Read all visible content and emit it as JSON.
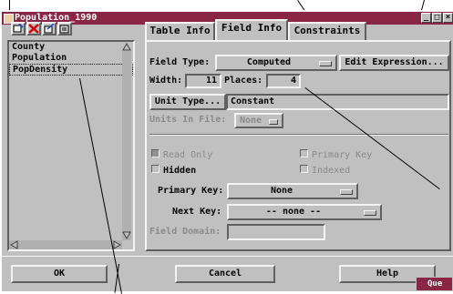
{
  "window": {
    "title": "Population_1990",
    "buttons": [
      "minimize-icon",
      "maximize-icon",
      "close-icon"
    ]
  },
  "toolbar": {
    "icons": [
      "add-field-icon",
      "delete-field-icon",
      "edit-icon",
      "import-icon"
    ]
  },
  "field_list": {
    "items": [
      "County",
      "Population",
      "PopDensity"
    ],
    "selected": "PopDensity"
  },
  "tabs": [
    {
      "label": "Table Info",
      "active": false
    },
    {
      "label": "Field Info",
      "active": true
    },
    {
      "label": "Constraints",
      "active": false
    }
  ],
  "field_info": {
    "field_type_label": "Field Type:",
    "field_type_value": "Computed",
    "edit_expression_label": "Edit Expression...",
    "width_label": "Width:",
    "width_value": "11",
    "places_label": "Places:",
    "places_value": "4",
    "unit_type_button": "Unit Type...",
    "unit_type_value": "Constant",
    "units_in_file_label": "Units In File:",
    "units_in_file_value": "None",
    "read_only_label": "Read Only",
    "primary_key_check_label": "Primary Key",
    "hidden_label": "Hidden",
    "indexed_label": "Indexed",
    "primary_key_label": "Primary Key:",
    "primary_key_value": "None",
    "next_key_label": "Next Key:",
    "next_key_value": "-- none --",
    "field_domain_label": "Field Domain:",
    "field_domain_value": ""
  },
  "footer": {
    "ok_label": "OK",
    "cancel_label": "Cancel",
    "help_label": "Help"
  },
  "corner_window": {
    "title_fragment": "Que"
  },
  "colors": {
    "titlebar": "#8b2545",
    "window_bg": "#c0c0c0"
  }
}
